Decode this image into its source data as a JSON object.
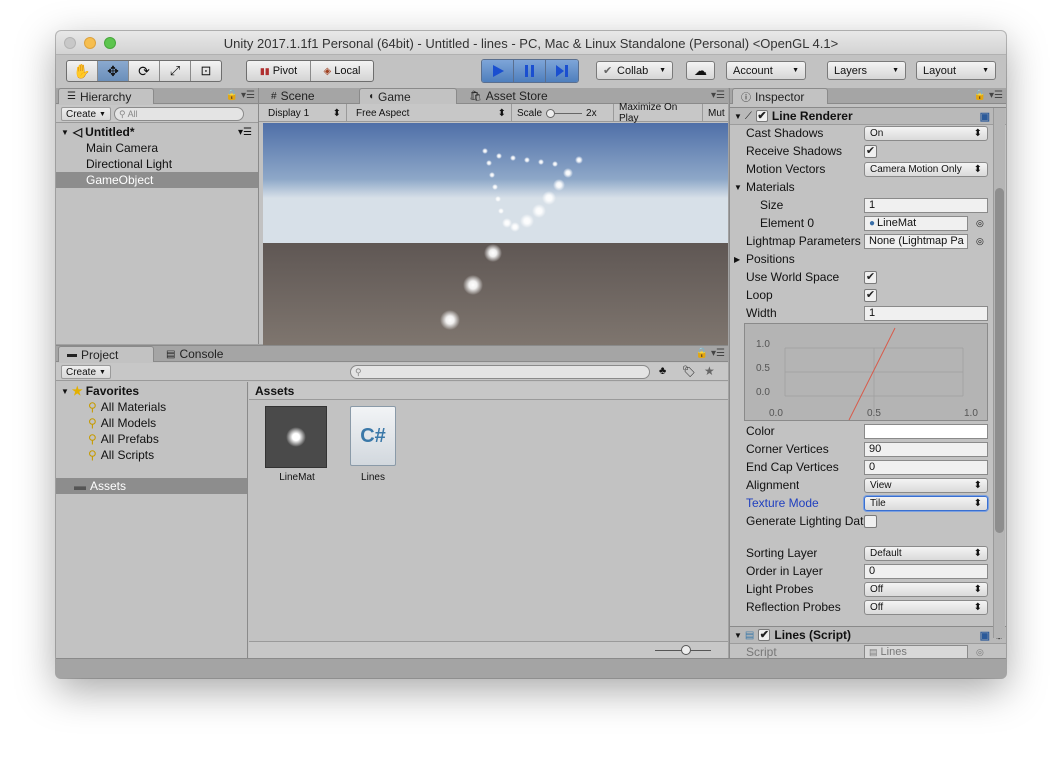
{
  "window": {
    "title": "Unity 2017.1.1f1 Personal (64bit) - Untitled - lines - PC, Mac & Linux Standalone (Personal) <OpenGL 4.1>"
  },
  "toolbar": {
    "tools": [
      "hand-icon",
      "move-icon",
      "rotate-icon",
      "scale-icon",
      "rect-icon"
    ],
    "pivot": "Pivot",
    "local": "Local",
    "collab": "Collab",
    "account": "Account",
    "layers": "Layers",
    "layout": "Layout"
  },
  "hierarchy": {
    "tab": "Hierarchy",
    "create": "Create",
    "search_placeholder": "All",
    "scene": "Untitled*",
    "items": [
      "Main Camera",
      "Directional Light",
      "GameObject"
    ],
    "selected": "GameObject"
  },
  "center_tabs": {
    "scene": "Scene",
    "game": "Game",
    "asset_store": "Asset Store"
  },
  "game_bar": {
    "display": "Display 1",
    "aspect": "Free Aspect",
    "scale_label": "Scale",
    "scale_value": "2x",
    "maximize": "Maximize On Play",
    "mute": "Mut"
  },
  "project": {
    "tab": "Project",
    "console_tab": "Console",
    "create": "Create",
    "favorites": "Favorites",
    "favorite_items": [
      "All Materials",
      "All Models",
      "All Prefabs",
      "All Scripts"
    ],
    "assets_folder": "Assets",
    "breadcrumb": "Assets",
    "assets": [
      {
        "name": "LineMat",
        "kind": "material"
      },
      {
        "name": "Lines",
        "kind": "script",
        "glyph": "C#"
      }
    ]
  },
  "inspector": {
    "tab": "Inspector",
    "component": "Line Renderer",
    "rows": {
      "cast_shadows": {
        "label": "Cast Shadows",
        "value": "On"
      },
      "receive_shadows": {
        "label": "Receive Shadows",
        "checked": true
      },
      "motion_vectors": {
        "label": "Motion Vectors",
        "value": "Camera Motion Only"
      },
      "materials": {
        "label": "Materials"
      },
      "size": {
        "label": "Size",
        "value": "1"
      },
      "element0": {
        "label": "Element 0",
        "value": "LineMat"
      },
      "lightmap": {
        "label": "Lightmap Parameters",
        "value": "None (Lightmap Pa"
      },
      "positions": {
        "label": "Positions"
      },
      "use_world_space": {
        "label": "Use World Space",
        "checked": true
      },
      "loop": {
        "label": "Loop",
        "checked": true
      },
      "width": {
        "label": "Width",
        "value": "1"
      },
      "color": {
        "label": "Color"
      },
      "corner_vertices": {
        "label": "Corner Vertices",
        "value": "90"
      },
      "end_cap_vertices": {
        "label": "End Cap Vertices",
        "value": "0"
      },
      "alignment": {
        "label": "Alignment",
        "value": "View"
      },
      "texture_mode": {
        "label": "Texture Mode",
        "value": "Tile"
      },
      "generate_lighting": {
        "label": "Generate Lighting Dat",
        "checked": false
      },
      "sorting_layer": {
        "label": "Sorting Layer",
        "value": "Default"
      },
      "order_in_layer": {
        "label": "Order in Layer",
        "value": "0"
      },
      "light_probes": {
        "label": "Light Probes",
        "value": "Off"
      },
      "reflection_probes": {
        "label": "Reflection Probes",
        "value": "Off"
      }
    },
    "curve": {
      "y_ticks": [
        "1.0",
        "0.5",
        "0.0"
      ],
      "x_ticks": [
        "0.0",
        "0.5",
        "1.0"
      ]
    },
    "script_component": "Lines (Script)",
    "script_label": "Script",
    "script_value": "Lines"
  },
  "colors": {
    "accent": "#4f7fbd",
    "selection": "#8d8d8d",
    "texture_mode_label": "#1f3fbf"
  }
}
